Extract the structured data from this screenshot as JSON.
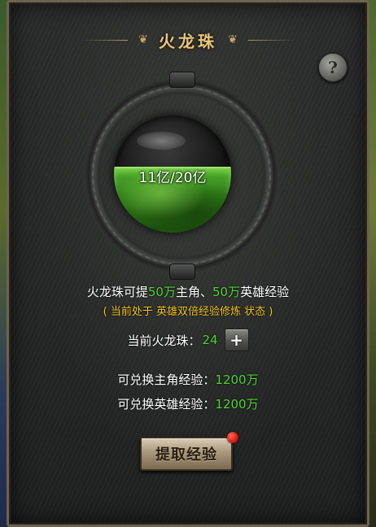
{
  "panel": {
    "title": "火龙珠",
    "help_label": "?"
  },
  "orb": {
    "current_value": "11亿",
    "max_value": "20亿",
    "display_text": "11亿/20亿",
    "fill_fraction": 0.55
  },
  "description": {
    "prefix": "火龙珠可提",
    "hero_main_amount": "50万",
    "mid": "主角、",
    "hero_amount": "50万",
    "suffix": "英雄经验",
    "state_text": "( 当前处于 英雄双倍经验修炼 状态 )"
  },
  "count": {
    "label": "当前火龙珠：",
    "value": "24",
    "add_label": "+"
  },
  "exchange": {
    "main_label": "可兑换主角经验：",
    "main_value": "1200万",
    "hero_label": "可兑换英雄经验：",
    "hero_value": "1200万"
  },
  "action": {
    "extract_label": "提取经验"
  },
  "colors": {
    "accent_green": "#4fd431",
    "state_yellow": "#f2c21a",
    "title_gold": "#e9c67a",
    "notification_red": "#d0150a"
  }
}
